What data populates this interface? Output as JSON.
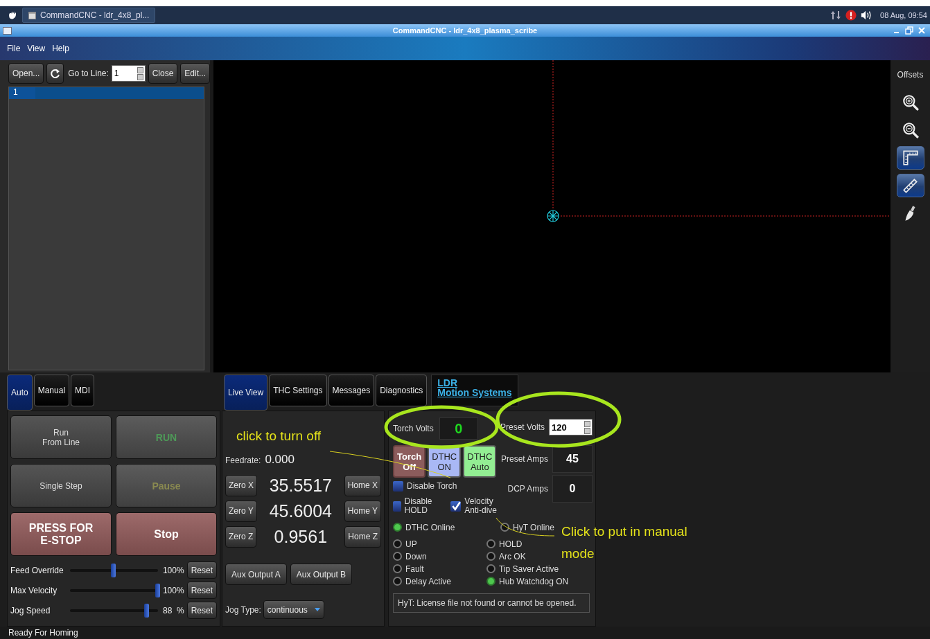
{
  "taskbar": {
    "task": "CommandCNC - ldr_4x8_pl...",
    "clock": "08 Aug, 09:54"
  },
  "window": {
    "title": "CommandCNC - ldr_4x8_plasma_scribe"
  },
  "menu": [
    "File",
    "View",
    "Help"
  ],
  "file_toolbar": {
    "open": "Open...",
    "goto_label": "Go to Line:",
    "goto_value": "1",
    "close": "Close",
    "edit": "Edit..."
  },
  "editor": {
    "lines": [
      {
        "number": "1",
        "selected": true
      }
    ]
  },
  "view_toolbar": {
    "offsets": "Offsets",
    "tools": [
      {
        "kind": "zoom_in",
        "selected": false
      },
      {
        "kind": "zoom_out",
        "selected": false
      },
      {
        "kind": "ruler",
        "selected": true
      },
      {
        "kind": "measure",
        "selected": true
      },
      {
        "kind": "clear",
        "selected": false
      }
    ]
  },
  "mode_tabs": [
    {
      "label": "Auto",
      "selected": true
    },
    {
      "label": "Manual",
      "selected": false
    },
    {
      "label": "MDI",
      "selected": false
    }
  ],
  "control_buttons": [
    {
      "label": "Run\nFrom Line",
      "kind": "normal"
    },
    {
      "label": "RUN",
      "kind": "run"
    },
    {
      "label": "Single Step",
      "kind": "normal"
    },
    {
      "label": "Pause",
      "kind": "pause"
    },
    {
      "label": "PRESS FOR\nE-STOP",
      "kind": "stop"
    },
    {
      "label": "Stop",
      "kind": "stop"
    }
  ],
  "sliders": [
    {
      "label": "Feed Override",
      "level": 0.5,
      "reading": "100%",
      "button": "Reset"
    },
    {
      "label": "Max Velocity",
      "level": 1,
      "reading": "100%",
      "button": "Reset"
    },
    {
      "label": "Jog Speed",
      "level": 0.88,
      "reading": "88  %",
      "button": "Reset"
    }
  ],
  "view_tabs": [
    {
      "label": "Live View",
      "selected": true
    },
    {
      "label": "THC Settings",
      "selected": false
    },
    {
      "label": "Messages",
      "selected": false
    },
    {
      "label": "Diagnostics",
      "selected": false
    }
  ],
  "logo": "LDR\nMotion  Systems",
  "position": {
    "feedrate_label": "Feedrate:",
    "feedrate": "0.000",
    "axes": [
      {
        "zero": "Zero X",
        "value": "35.5517",
        "home": "Home X"
      },
      {
        "zero": "Zero Y",
        "value": "45.6004",
        "home": "Home Y"
      },
      {
        "zero": "Zero Z",
        "value": "0.9561",
        "home": "Home Z"
      }
    ],
    "aux": [
      "Aux Output A",
      "Aux Output B"
    ],
    "jog_type_label": "Jog Type:",
    "jog_type": "continuous"
  },
  "thc": {
    "torch_volts_label": "Torch Volts",
    "torch_volts": "0",
    "buttons": [
      {
        "label": "Torch\nOff",
        "color": "#8c5c5c"
      },
      {
        "label": "DTHC\nON",
        "color": "#a9b8f5"
      },
      {
        "label": "DTHC\nAuto",
        "color": "#93ee93"
      }
    ],
    "checkboxes": [
      {
        "label": "Disable Torch",
        "checked": false
      },
      {
        "label": "Disable HOLD",
        "checked": false
      },
      {
        "label": "Velocity\nAnti-dive",
        "checked": true
      }
    ],
    "fields": [
      {
        "label": "Preset Volts",
        "value": "120",
        "kind": "spin"
      },
      {
        "label": "Preset Amps",
        "value": "45",
        "kind": "readout"
      },
      {
        "label": "DCP Amps",
        "value": "0",
        "kind": "readout"
      }
    ],
    "leds": [
      {
        "label": "DTHC Online",
        "on": true
      },
      {
        "label": "HyT Online",
        "on": false
      },
      {
        "label": "UP",
        "on": false
      },
      {
        "label": "HOLD",
        "on": false
      },
      {
        "label": "Down",
        "on": false
      },
      {
        "label": "Arc OK",
        "on": false
      },
      {
        "label": "Fault",
        "on": false
      },
      {
        "label": "Tip Saver Active",
        "on": false
      },
      {
        "label": "Delay Active",
        "on": false
      },
      {
        "label": "Hub Watchdog ON",
        "on": true
      }
    ],
    "message": "HyT: License file not found or cannot be opened."
  },
  "annotations": [
    "click to turn off",
    "Click to put in manual mode"
  ],
  "status_bar": "Ready For Homing"
}
